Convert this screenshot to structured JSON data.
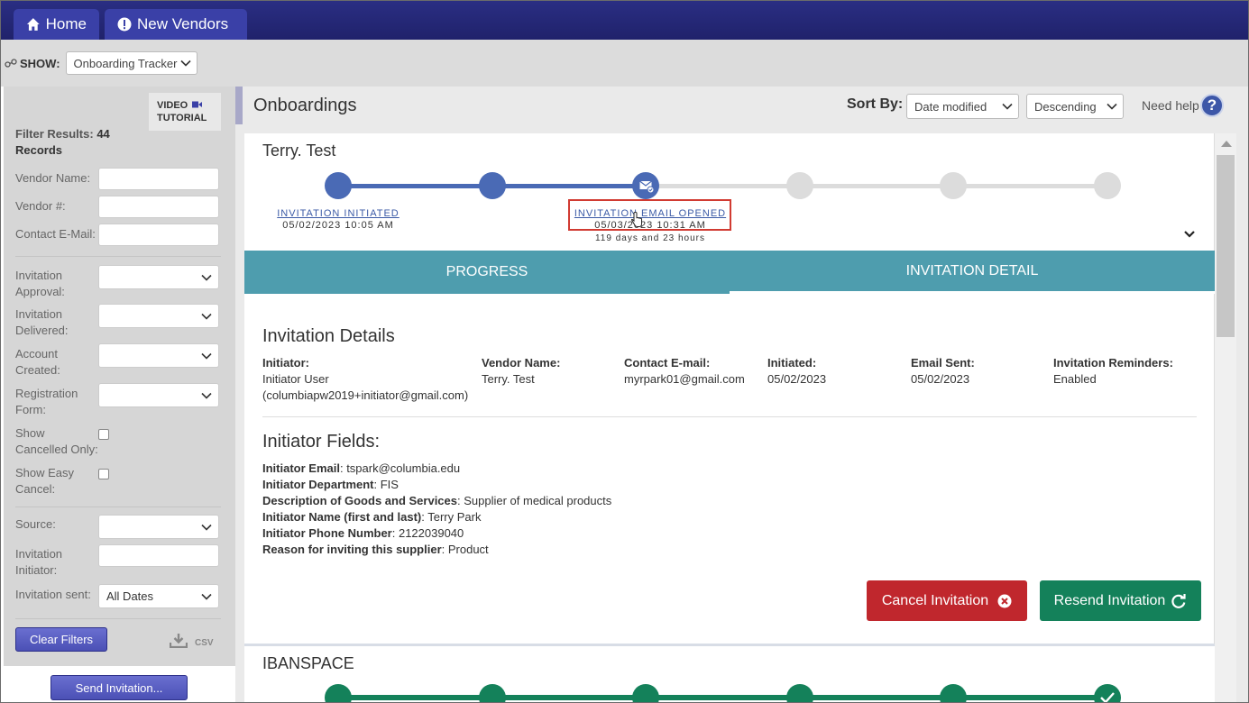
{
  "nav": {
    "home_label": "Home",
    "vendors_label": "New Vendors"
  },
  "show": {
    "label": "SHOW:",
    "selected": "Onboarding Tracker"
  },
  "sidebar": {
    "video_line1": "VIDEO",
    "video_line2": "TUTORIAL",
    "filter_results_label": "Filter Results:",
    "filter_results_count": "44",
    "filter_results_suffix": "Records",
    "vendor_name_label": "Vendor Name:",
    "vendor_num_label": "Vendor #:",
    "contact_email_label": "Contact E-Mail:",
    "inv_approval_label1": "Invitation",
    "inv_approval_label2": "Approval:",
    "inv_delivered_label1": "Invitation",
    "inv_delivered_label2": "Delivered:",
    "account_created_label1": "Account",
    "account_created_label2": "Created:",
    "registration_form_label1": "Registration",
    "registration_form_label2": "Form:",
    "show_cancelled_label1": "Show",
    "show_cancelled_label2": "Cancelled Only:",
    "show_easy_label1": "Show Easy",
    "show_easy_label2": "Cancel:",
    "source_label": "Source:",
    "inv_initiator_label1": "Invitation",
    "inv_initiator_label2": "Initiator:",
    "inv_sent_label": "Invitation sent:",
    "inv_sent_value": "All Dates",
    "clear_filters": "Clear Filters",
    "csv_label": "CSV",
    "send_invitation": "Send Invitation..."
  },
  "main": {
    "title": "Onboardings",
    "sort_by_label": "Sort By:",
    "sort_field": "Date modified",
    "sort_order": "Descending",
    "need_help": "Need help",
    "help_glyph": "?"
  },
  "onboarding": {
    "name": "Terry. Test",
    "step1_label": "INVITATION INITIATED",
    "step1_date": "05/02/2023 10:05 AM",
    "step3_label": "INVITATION EMAIL OPENED",
    "step3_date": "05/03/2023 10:31 AM",
    "step3_elapsed": "119 days and 23 hours",
    "tab_progress": "PROGRESS",
    "tab_detail": "INVITATION DETAIL",
    "details_title": "Invitation Details",
    "initiator_label": "Initiator:",
    "initiator_name": "Initiator User",
    "initiator_email": "(columbiapw2019+initiator@gmail.com)",
    "vendor_name_label": "Vendor Name:",
    "vendor_name": "Terry. Test",
    "contact_email_label": "Contact E-mail:",
    "contact_email": "myrpark01@gmail.com",
    "initiated_label": "Initiated:",
    "initiated": "05/02/2023",
    "email_sent_label": "Email Sent:",
    "email_sent": "05/02/2023",
    "reminders_label": "Invitation Reminders:",
    "reminders": "Enabled",
    "fields_title": "Initiator Fields:",
    "f1_label": "Initiator Email",
    "f1_value": ": tspark@columbia.edu",
    "f2_label": "Initiator Department",
    "f2_value": ": FIS",
    "f3_label": "Description of Goods and Services",
    "f3_value": ": Supplier of medical products",
    "f4_label": "Initiator Name (first and last)",
    "f4_value": ": Terry Park",
    "f5_label": "Initiator Phone Number",
    "f5_value": ": 2122039040",
    "f6_label": "Reason for inviting this supplier",
    "f6_value": ": Product",
    "cancel_label": "Cancel Invitation",
    "resend_label": "Resend Invitation"
  },
  "onboarding2": {
    "name": "IBANSPACE"
  },
  "colors": {
    "nav": "#20226b",
    "tab": "#3a40a7",
    "progress": "#4a6ab5",
    "tabsbar": "#4e9dae",
    "cancel": "#c0272d",
    "resend": "#14815a"
  },
  "icons": [
    "home-icon",
    "alert-icon",
    "link-icon",
    "video-icon",
    "download-icon",
    "help-icon",
    "email-opened-icon",
    "cancel-x-icon",
    "refresh-icon",
    "check-icon",
    "cursor-icon"
  ]
}
